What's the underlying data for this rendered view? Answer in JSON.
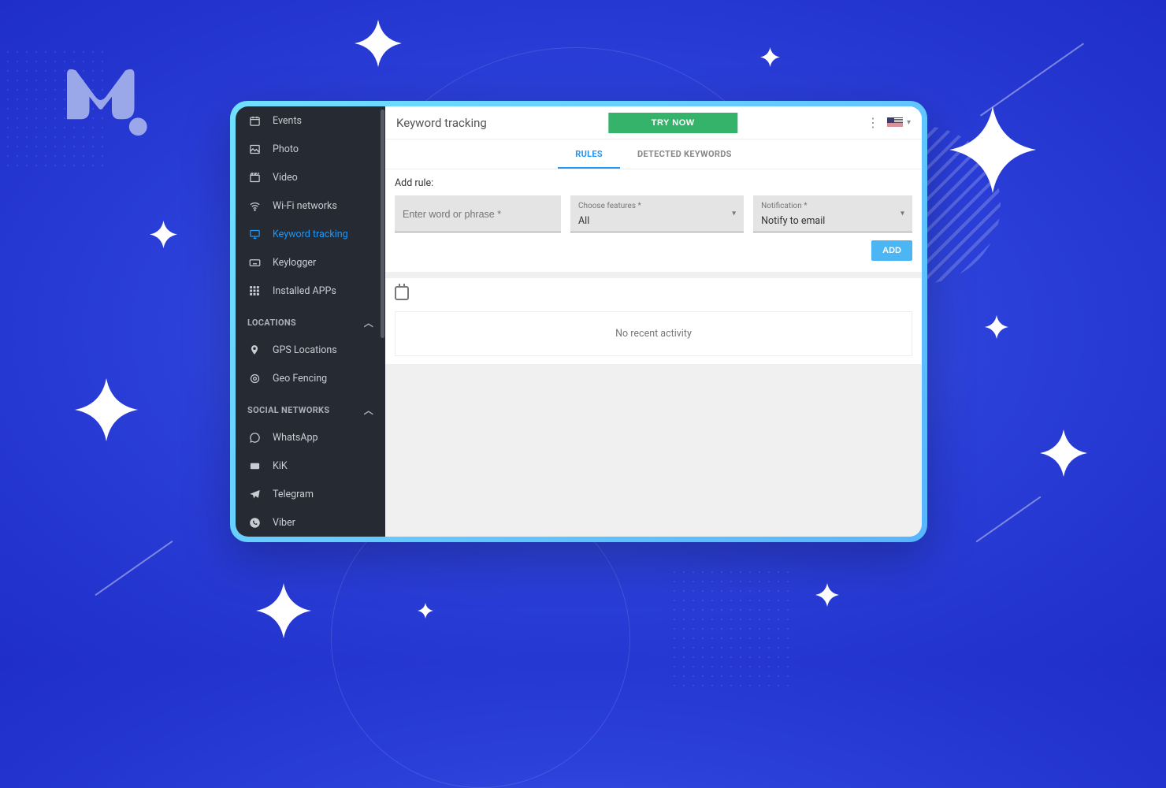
{
  "sidebar": {
    "items": [
      {
        "label": "Events",
        "icon": "calendar"
      },
      {
        "label": "Photo",
        "icon": "image"
      },
      {
        "label": "Video",
        "icon": "clapper"
      },
      {
        "label": "Wi-Fi networks",
        "icon": "wifi"
      },
      {
        "label": "Keyword tracking",
        "icon": "monitor",
        "active": true
      },
      {
        "label": "Keylogger",
        "icon": "keyboard"
      },
      {
        "label": "Installed APPs",
        "icon": "grid"
      }
    ],
    "sections": [
      {
        "title": "LOCATIONS",
        "items": [
          {
            "label": "GPS Locations",
            "icon": "pin"
          },
          {
            "label": "Geo Fencing",
            "icon": "target"
          }
        ]
      },
      {
        "title": "SOCIAL NETWORKS",
        "items": [
          {
            "label": "WhatsApp",
            "icon": "whatsapp"
          },
          {
            "label": "KiK",
            "icon": "kik"
          },
          {
            "label": "Telegram",
            "icon": "telegram"
          },
          {
            "label": "Viber",
            "icon": "viber"
          }
        ]
      }
    ]
  },
  "header": {
    "title": "Keyword tracking",
    "try_now": "TRY NOW",
    "locale": "en-US"
  },
  "tabs": {
    "rules": "RULES",
    "detected": "DETECTED KEYWORDS",
    "active": "rules"
  },
  "rule_form": {
    "heading": "Add rule:",
    "word_placeholder": "Enter word or phrase *",
    "features_label": "Choose features *",
    "features_value": "All",
    "notification_label": "Notification *",
    "notification_value": "Notify to email",
    "add_button": "ADD"
  },
  "activity": {
    "empty": "No recent activity"
  }
}
